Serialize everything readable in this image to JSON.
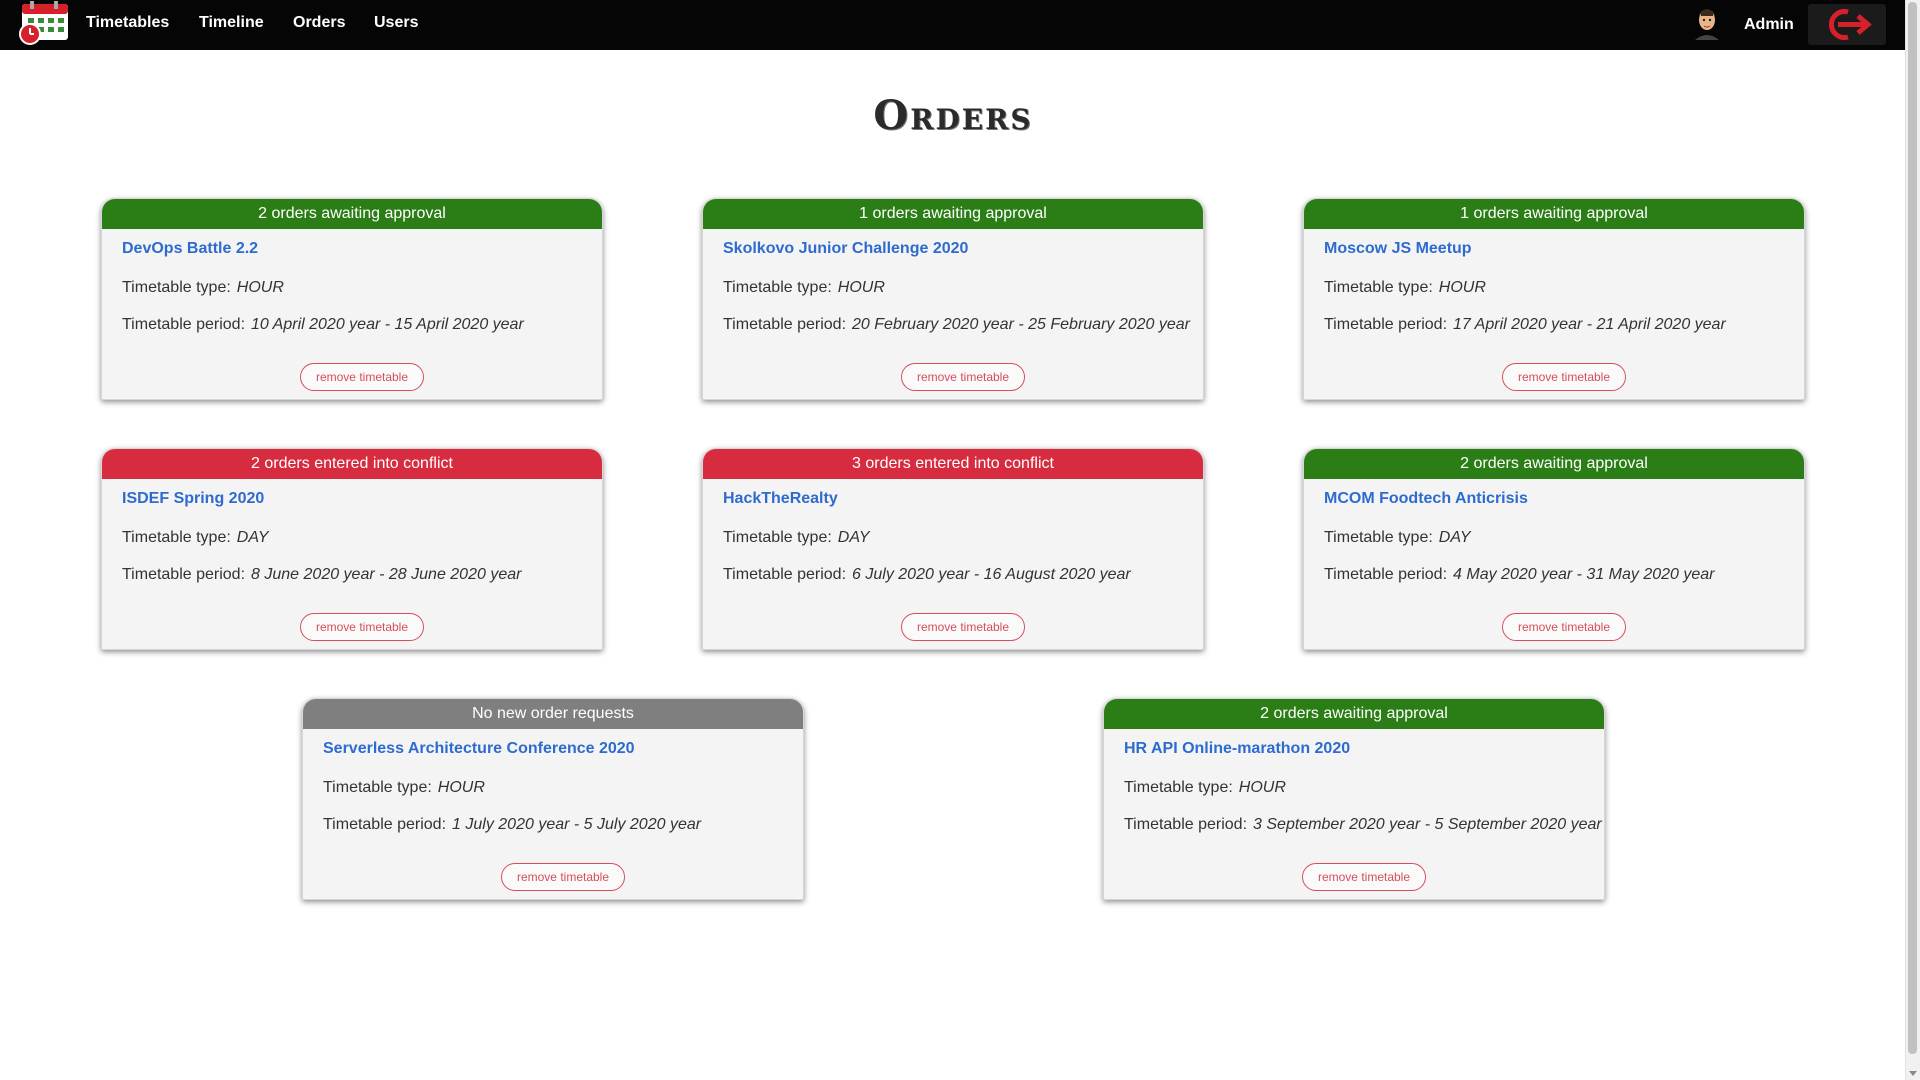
{
  "nav": {
    "items": [
      "Timetables",
      "Timeline",
      "Orders",
      "Users"
    ],
    "user_name": "Admin",
    "logo_icon": "calendar-clock-icon",
    "logout_icon": "logout-arrow-icon",
    "accent": "#d6202b"
  },
  "page": {
    "title": "Orders"
  },
  "labels": {
    "type": "Timetable type:",
    "period": "Timetable period:",
    "remove": "remove timetable"
  },
  "status_colors": {
    "approval": "#2b7e16",
    "conflict": "#d72c3f",
    "none": "#7f7f7f"
  },
  "cards": [
    {
      "status": "2 orders awaiting approval",
      "title": "DevOps Battle 2.2",
      "type": "HOUR",
      "period": "10 April 2020 year - 15 April 2020 year"
    },
    {
      "status": "1 orders awaiting approval",
      "title": "Skolkovo Junior Challenge 2020",
      "type": "HOUR",
      "period": "20 February 2020 year - 25 February 2020 year"
    },
    {
      "status": "1 orders awaiting approval",
      "title": "Moscow JS Meetup",
      "type": "HOUR",
      "period": "17 April 2020 year - 21 April 2020 year"
    },
    {
      "status": "2 orders entered into conflict",
      "title": "ISDEF Spring 2020",
      "type": "DAY",
      "period": "8 June 2020 year - 28 June 2020 year"
    },
    {
      "status": "3 orders entered into conflict",
      "title": "HackTheRealty",
      "type": "DAY",
      "period": "6 July 2020 year - 16 August 2020 year"
    },
    {
      "status": "2 orders awaiting approval",
      "title": "MCOM Foodtech Anticrisis",
      "type": "DAY",
      "period": "4 May 2020 year - 31 May 2020 year"
    },
    {
      "status": "No new order requests",
      "title": "Serverless Architecture Conference 2020",
      "type": "HOUR",
      "period": "1 July 2020 year - 5 July 2020 year"
    },
    {
      "status": "2 orders awaiting approval",
      "title": "HR API Online-marathon 2020",
      "type": "HOUR",
      "period": "3 September 2020 year - 5 September 2020 year"
    }
  ]
}
